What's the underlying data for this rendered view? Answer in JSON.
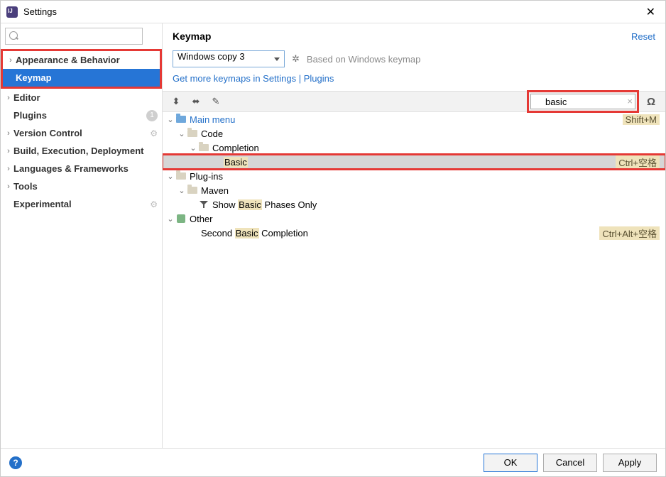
{
  "window": {
    "title": "Settings",
    "close": "✕"
  },
  "sidebar": {
    "search_value": "",
    "items": [
      {
        "label": "Appearance & Behavior",
        "chev": "›"
      },
      {
        "label": "Keymap",
        "chev": ""
      },
      {
        "label": "Editor",
        "chev": "›"
      },
      {
        "label": "Plugins",
        "chev": "",
        "badge": "1"
      },
      {
        "label": "Version Control",
        "chev": "›"
      },
      {
        "label": "Build, Execution, Deployment",
        "chev": "›"
      },
      {
        "label": "Languages & Frameworks",
        "chev": "›"
      },
      {
        "label": "Tools",
        "chev": "›"
      },
      {
        "label": "Experimental",
        "chev": ""
      }
    ]
  },
  "main": {
    "heading": "Keymap",
    "reset": "Reset",
    "keymap_selected": "Windows copy 3",
    "based_on": "Based on Windows keymap",
    "links": {
      "more": "Get more keymaps in Settings",
      "sep": " | ",
      "plugins": "Plugins"
    },
    "search_value": "basic",
    "tree": {
      "main_menu": "Main menu",
      "main_menu_shortcut": "Shift+M",
      "code": "Code",
      "completion": "Completion",
      "basic": "Basic",
      "basic_shortcut": "Ctrl+空格",
      "plugins": "Plug-ins",
      "maven": "Maven",
      "show_pre": "Show ",
      "show_hl": "Basic",
      "show_post": " Phases Only",
      "other": "Other",
      "second_pre": "Second ",
      "second_hl": "Basic",
      "second_post": " Completion",
      "second_shortcut": "Ctrl+Alt+空格"
    }
  },
  "footer": {
    "ok": "OK",
    "cancel": "Cancel",
    "apply": "Apply"
  }
}
